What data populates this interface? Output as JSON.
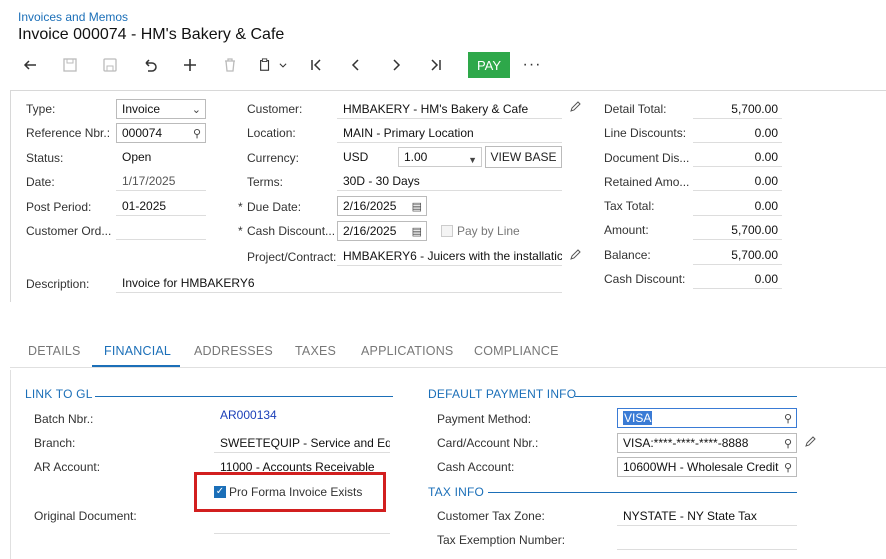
{
  "breadcrumb": "Invoices and Memos",
  "page_title": "Invoice 000074 - HM's Bakery & Cafe",
  "toolbar": {
    "pay_label": "PAY",
    "more_label": "···"
  },
  "left_fields": {
    "type_label": "Type:",
    "type_value": "Invoice",
    "ref_label": "Reference Nbr.:",
    "ref_value": "000074",
    "status_label": "Status:",
    "status_value": "Open",
    "date_label": "Date:",
    "date_value": "1/17/2025",
    "post_period_label": "Post Period:",
    "post_period_value": "01-2025",
    "customer_ord_label": "Customer Ord...",
    "description_label": "Description:",
    "description_value": "Invoice for HMBAKERY6"
  },
  "middle_fields": {
    "customer_label": "Customer:",
    "customer_value": "HMBAKERY - HM's Bakery & Cafe",
    "location_label": "Location:",
    "location_value": "MAIN - Primary Location",
    "currency_label": "Currency:",
    "currency_value": "USD",
    "rate_value": "1.00",
    "view_base_label": "VIEW BASE",
    "terms_label": "Terms:",
    "terms_value": "30D - 30 Days",
    "due_date_label": "Due Date:",
    "due_date_value": "2/16/2025",
    "cash_discount_label": "Cash Discount...",
    "cash_discount_value": "2/16/2025",
    "pay_by_line_label": "Pay by Line",
    "project_label": "Project/Contract:",
    "project_value": "HMBAKERY6 - Juicers with the installatic",
    "required_mark": "*"
  },
  "totals": {
    "detail_total_label": "Detail Total:",
    "detail_total_value": "5,700.00",
    "line_discounts_label": "Line Discounts:",
    "line_discounts_value": "0.00",
    "document_dis_label": "Document Dis...",
    "document_dis_value": "0.00",
    "retained_label": "Retained Amo...",
    "retained_value": "0.00",
    "tax_total_label": "Tax Total:",
    "tax_total_value": "0.00",
    "amount_label": "Amount:",
    "amount_value": "5,700.00",
    "balance_label": "Balance:",
    "balance_value": "5,700.00",
    "cash_discount_label": "Cash Discount:",
    "cash_discount_value": "0.00"
  },
  "tabs": [
    "DETAILS",
    "FINANCIAL",
    "ADDRESSES",
    "TAXES",
    "APPLICATIONS",
    "COMPLIANCE"
  ],
  "link_to_gl": {
    "heading": "LINK TO GL",
    "batch_label": "Batch Nbr.:",
    "batch_value": "AR000134",
    "branch_label": "Branch:",
    "branch_value": "SWEETEQUIP - Service and Eq",
    "ar_account_label": "AR Account:",
    "ar_account_value": "11000 - Accounts Receivable",
    "pro_forma_label": "Pro Forma Invoice Exists",
    "original_doc_label": "Original Document:"
  },
  "payment_info": {
    "heading": "DEFAULT PAYMENT INFO",
    "method_label": "Payment Method:",
    "method_value": "VISA",
    "card_label": "Card/Account Nbr.:",
    "card_value": "VISA:****-****-****-8888",
    "cash_account_label": "Cash Account:",
    "cash_account_value": "10600WH - Wholesale Credit"
  },
  "tax_info": {
    "heading": "TAX INFO",
    "zone_label": "Customer Tax Zone:",
    "zone_value": "NYSTATE - NY State Tax",
    "exemption_label": "Tax Exemption Number:"
  },
  "colors": {
    "accent": "#1b6fb8",
    "pay_button": "#2ea84a",
    "highlight_border": "#d21f1f"
  }
}
